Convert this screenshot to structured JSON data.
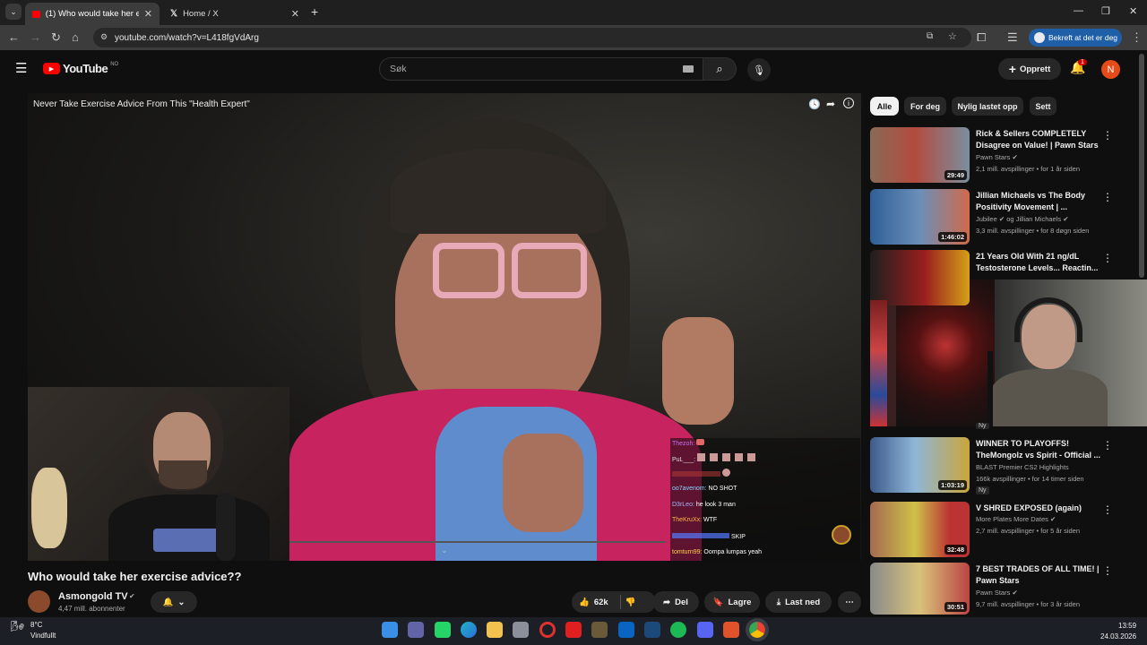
{
  "browser": {
    "tabs": [
      {
        "label": "(1) Who would take her exercis"
      },
      {
        "label": "Home / X"
      }
    ],
    "url": "youtube.com/watch?v=L418fgVdArg",
    "profile_label": "Bekreft at det er deg"
  },
  "youtube": {
    "logo": "YouTube",
    "region": "NO",
    "search_placeholder": "Søk",
    "create_label": "Opprett",
    "notif_count": "1",
    "avatar_letter": "N"
  },
  "video": {
    "overlay_title": "Never Take Exercise Advice From This \"Health Expert\"",
    "title": "Who would take her exercise advice??",
    "channel": "Asmongold TV",
    "subscribers": "4,47 mill. abonnenter",
    "likes": "62k",
    "share_label": "Del",
    "save_label": "Lagre",
    "download_label": "Last ned"
  },
  "chat": [
    {
      "user": "Thezoh:",
      "msg": "",
      "color": "#c86df0"
    },
    {
      "user": "PuL___:",
      "msg": "",
      "color": "#d8d8d8"
    },
    {
      "user": "",
      "msg": "",
      "color": "#c33"
    },
    {
      "user": "oo7avenom:",
      "msg": "NO SHOT",
      "color": "#8fd0ff"
    },
    {
      "user": "D3rLeo:",
      "msg": "he look 3 man",
      "color": "#aab4ff"
    },
    {
      "user": "TheKruXx:",
      "msg": "WTF",
      "color": "#ffb347"
    },
    {
      "user": "",
      "msg": "SKIP",
      "color": "#5577ff"
    },
    {
      "user": "tomturn99:",
      "msg": "Oompa lumpas yeah",
      "color": "#ffd24c"
    }
  ],
  "sidebar": {
    "chips": [
      "Alle",
      "For deg",
      "Nylig lastet opp",
      "Sett"
    ],
    "recommendations": [
      {
        "title": "Rick & Sellers COMPLETELY Disagree on Value! | Pawn Stars",
        "channel": "Pawn Stars",
        "meta": "2,1 mill. avspillinger • for 1 år siden",
        "duration": "29:49",
        "badge": ""
      },
      {
        "title": "Jillian Michaels vs The Body Positivity Movement | ...",
        "channel": "Jubilee",
        "channel2": "og Jillian Michaels",
        "meta": "3,3 mill. avspillinger • for 8 døgn siden",
        "duration": "1:46:02",
        "badge": ""
      },
      {
        "title": "21 Years Old With 21 ng/dL Testosterone Levels... Reactin...",
        "channel": "",
        "meta": "",
        "duration": "",
        "badge": ""
      },
      {
        "title": "WINNER TO PLAYOFFS! TheMongolz vs Spirit - Official ...",
        "channel": "BLAST Premier CS2 Highlights",
        "meta": "166k avspillinger • for 14 timer siden",
        "duration": "1:03:19",
        "badge": "Ny"
      },
      {
        "title": "V SHRED EXPOSED (again)",
        "channel": "More Plates More Dates",
        "meta": "2,7 mill. avspillinger • for 5 år siden",
        "duration": "32:48",
        "badge": ""
      },
      {
        "title": "7 BEST TRADES OF ALL TIME! | Pawn Stars",
        "channel": "Pawn Stars",
        "meta": "9,7 mill. avspillinger • for 3 år siden",
        "duration": "30:51",
        "badge": ""
      }
    ],
    "extra_badge": "Ny"
  },
  "taskbar": {
    "temp": "8°C",
    "weather": "Vindfullt",
    "time": "13:59",
    "date": "24.03.2026"
  }
}
